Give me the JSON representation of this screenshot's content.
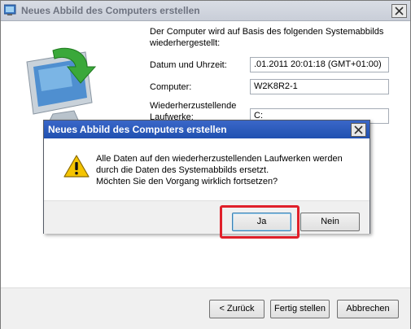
{
  "window": {
    "title": "Neues Abbild des Computers erstellen",
    "intro_line1": "Der Computer wird auf Basis des folgenden Systemabbilds",
    "intro_line2": "wiederhergestellt:",
    "fields": {
      "datetime_label": "Datum und Uhrzeit:",
      "datetime_value": ".01.2011 20:01:18 (GMT+01:00)",
      "computer_label": "Computer:",
      "computer_value": "W2K8R2-1",
      "drives_label_line1": "Wiederherzustellende",
      "drives_label_line2": "Laufwerke:",
      "drives_value": "C:"
    },
    "buttons": {
      "back": "< Zurück",
      "finish": "Fertig stellen",
      "cancel": "Abbrechen"
    }
  },
  "dialog": {
    "title": "Neues Abbild des Computers erstellen",
    "message_line1": "Alle Daten auf den wiederherzustellenden Laufwerken werden",
    "message_line2": "durch die Daten des Systemabbilds ersetzt.",
    "message_line3": "Möchten Sie den Vorgang wirklich fortsetzen?",
    "yes": "Ja",
    "no": "Nein"
  },
  "highlight_color": "#e0202a",
  "icons": [
    "window-icon",
    "close-icon",
    "monitor-restore-icon",
    "warning-icon"
  ]
}
